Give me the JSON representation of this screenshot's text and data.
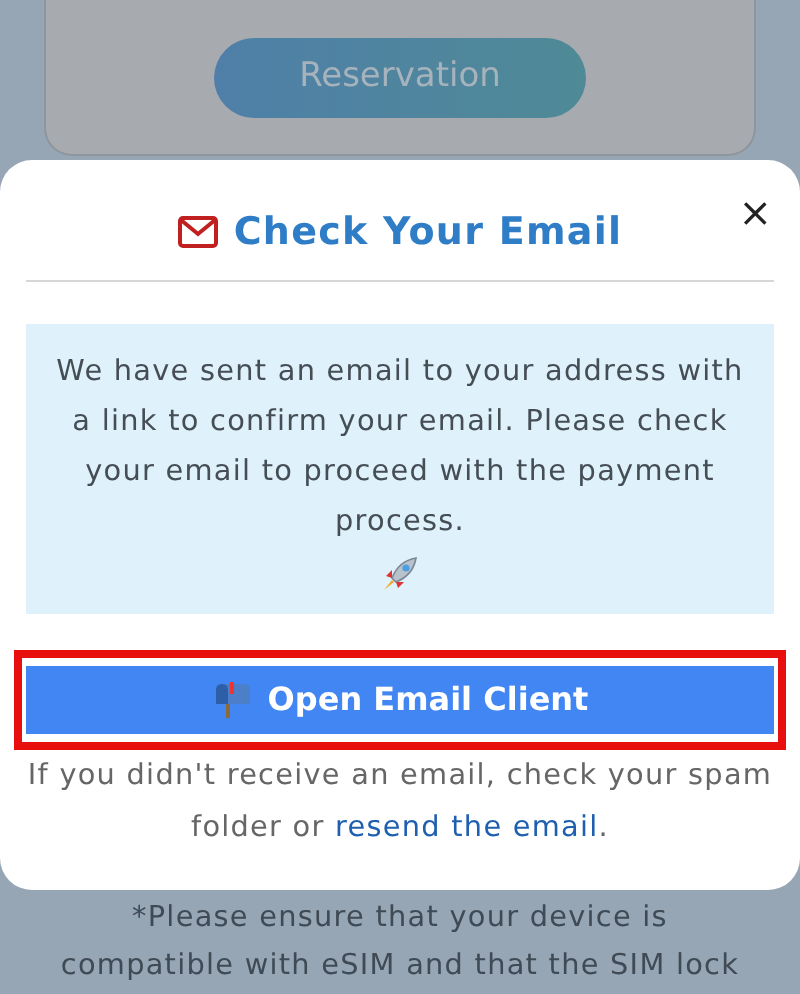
{
  "background": {
    "reservation_button": "Reservation",
    "note_lines": [
      "*Please ensure that your device is",
      "compatible with eSIM and that the SIM lock"
    ]
  },
  "dialog": {
    "title": "Check Your Email",
    "close": "×",
    "message": "We have sent an email to your address with a link to confirm your email. Please check your email to proceed with the payment process.",
    "button": {
      "label": "Open Email Client",
      "highlighted": true
    },
    "footer_text": "If you didn't receive an email, check your spam folder or ",
    "footer_link": "resend the email",
    "footer_end": "."
  }
}
